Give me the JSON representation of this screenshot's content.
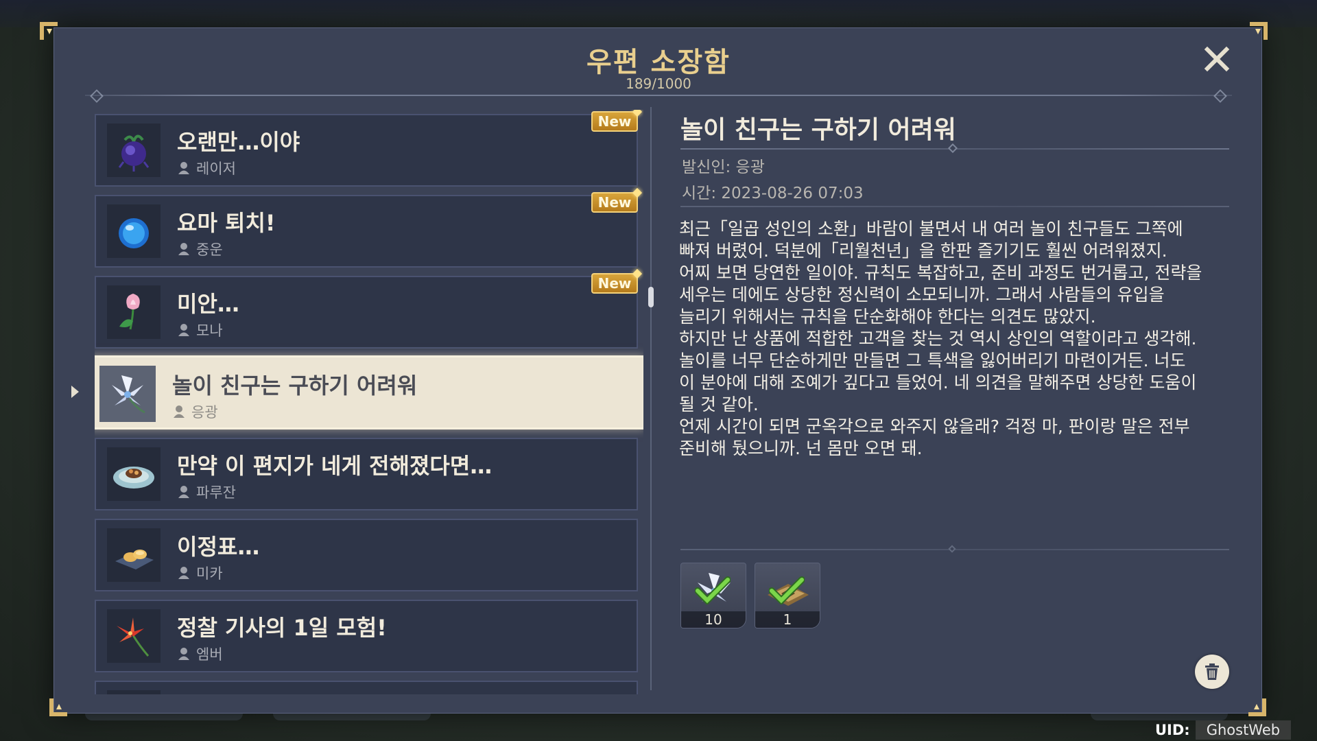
{
  "mailbox": {
    "title": "우편 소장함",
    "count": "189/1000"
  },
  "list": {
    "items": [
      {
        "subject": "오랜만…이야",
        "sender": "레이저",
        "is_new": true,
        "icon": "purple-flower-icon",
        "selected": false,
        "new_label": "New"
      },
      {
        "subject": "요마 퇴치!",
        "sender": "중운",
        "is_new": true,
        "icon": "blue-orb-icon",
        "selected": false,
        "new_label": "New"
      },
      {
        "subject": "미안…",
        "sender": "모나",
        "is_new": true,
        "icon": "pink-lotus-icon",
        "selected": false,
        "new_label": "New"
      },
      {
        "subject": "놀이 친구는 구하기 어려워",
        "sender": "응광",
        "is_new": false,
        "icon": "glaze-lily-icon",
        "selected": true
      },
      {
        "subject": "만약 이 편지가 네게 전해졌다면…",
        "sender": "파루잔",
        "is_new": false,
        "icon": "dish-plate-icon",
        "selected": false
      },
      {
        "subject": "이정표…",
        "sender": "미카",
        "is_new": false,
        "icon": "pastry-tray-icon",
        "selected": false
      },
      {
        "subject": "정찰 기사의 1일 모험!",
        "sender": "엠버",
        "is_new": false,
        "icon": "red-lily-icon",
        "selected": false
      },
      {
        "subject": "",
        "sender": "",
        "is_new": false,
        "icon": "partial-item-icon",
        "selected": false
      }
    ]
  },
  "mail": {
    "subject": "놀이 친구는 구하기 어려워",
    "sender_line": "발신인: 응광",
    "time_line": "시간: 2023-08-26 07:03",
    "body": "최근「일곱 성인의 소환」바람이 불면서 내 여러 놀이 친구들도 그쪽에\n빠져 버렸어. 덕분에「리월천년」을 한판 즐기기도 훨씬 어려워졌지.\n어찌 보면 당연한 일이야. 규칙도 복잡하고, 준비 과정도 번거롭고, 전략을\n세우는 데에도 상당한 정신력이 소모되니까. 그래서 사람들의 유입을\n늘리기 위해서는 규칙을 단순화해야 한다는 의견도 많았지.\n하지만 난 상품에 적합한 고객을 찾는 것 역시 상인의 역할이라고 생각해.\n놀이를 너무 단순하게만 만들면 그 특색을 잃어버리기 마련이거든. 너도\n이 분야에 대해 조예가 깊다고 들었어. 네 의견을 말해주면 상당한 도움이\n될 것 같아.\n언제 시간이 되면 군옥각으로 와주지 않을래? 걱정 마, 판이랑 말은 전부\n준비해 뒀으니까. 넌 몸만 오면 돼.",
    "attachments": [
      {
        "icon": "glaze-lily-icon",
        "quantity": "10",
        "claimed": true
      },
      {
        "icon": "card-box-icon",
        "quantity": "1",
        "claimed": true
      }
    ]
  },
  "footer": {
    "uid_label": "UID:",
    "uid_value": "GhostWeb"
  },
  "colors": {
    "title_gold": "#e9cf8e",
    "panel_bg": "#3b4256",
    "item_bg": "#2e3548",
    "selected_bg": "#ece5d4",
    "new_badge": "#d8a53b",
    "check_green": "#7bd64a"
  }
}
